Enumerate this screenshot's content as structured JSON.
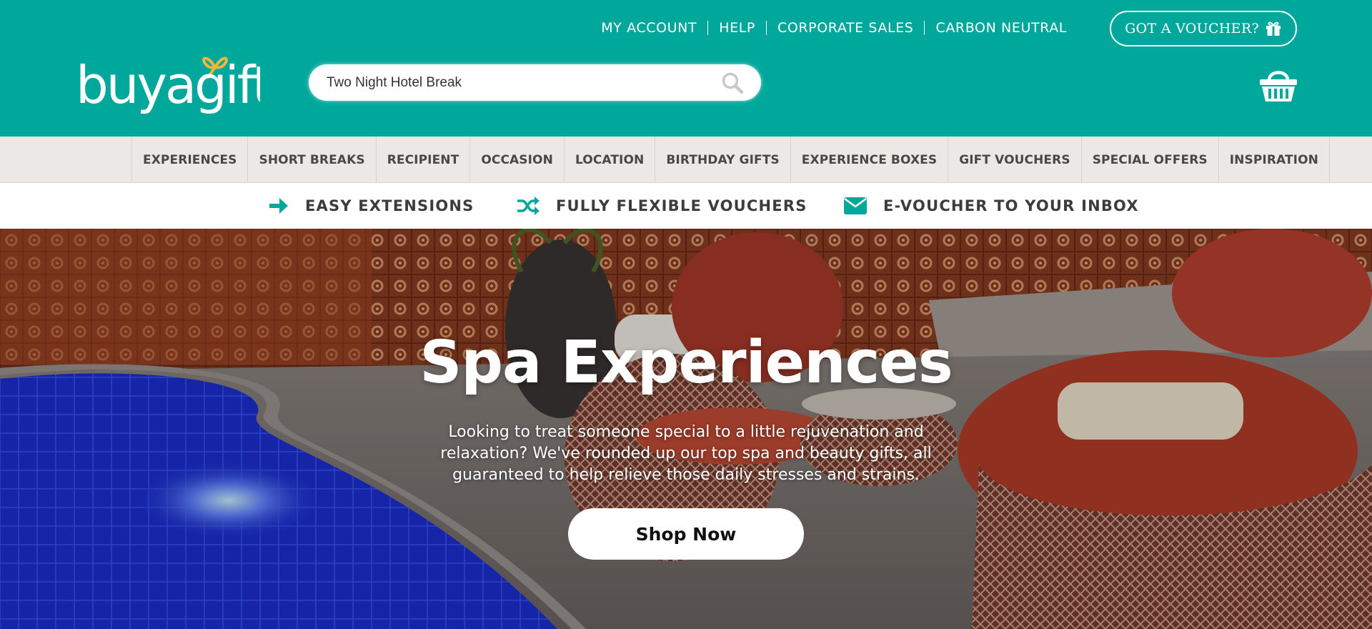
{
  "header": {
    "utility_links": [
      {
        "label": "MY ACCOUNT"
      },
      {
        "label": "HELP"
      },
      {
        "label": "CORPORATE SALES"
      },
      {
        "label": "CARBON NEUTRAL"
      }
    ],
    "voucher_button": "GOT A VOUCHER?",
    "logo_text": "buyagift",
    "search": {
      "value": "Two Night Hotel Break",
      "placeholder": "Two Night Hotel Break"
    },
    "icons": {
      "search": "search-icon",
      "basket": "basket-icon",
      "gift": "gift-icon"
    }
  },
  "nav": {
    "items": [
      {
        "label": "EXPERIENCES"
      },
      {
        "label": "SHORT BREAKS"
      },
      {
        "label": "RECIPIENT"
      },
      {
        "label": "OCCASION"
      },
      {
        "label": "LOCATION"
      },
      {
        "label": "BIRTHDAY GIFTS"
      },
      {
        "label": "EXPERIENCE BOXES"
      },
      {
        "label": "GIFT VOUCHERS"
      },
      {
        "label": "SPECIAL OFFERS"
      },
      {
        "label": "INSPIRATION"
      }
    ]
  },
  "usp": {
    "items": [
      {
        "label": "EASY EXTENSIONS",
        "icon": "arrow-right-icon"
      },
      {
        "label": "FULLY FLEXIBLE VOUCHERS",
        "icon": "shuffle-icon"
      },
      {
        "label": "E-VOUCHER TO YOUR INBOX",
        "icon": "envelope-icon"
      }
    ]
  },
  "hero": {
    "title": "Spa Experiences",
    "text": "Looking to treat someone special to a little rejuvenation and relaxation? We've rounded up our top spa and beauty gifts, all guaranteed to help relieve those daily stresses and strains.",
    "cta": "Shop Now"
  },
  "colors": {
    "brand_teal": "#00a89c",
    "logo_accent": "#f2b63a",
    "nav_bg": "#ebe9e6",
    "nav_text": "#4b4743",
    "usp_text": "#3f3b38"
  }
}
